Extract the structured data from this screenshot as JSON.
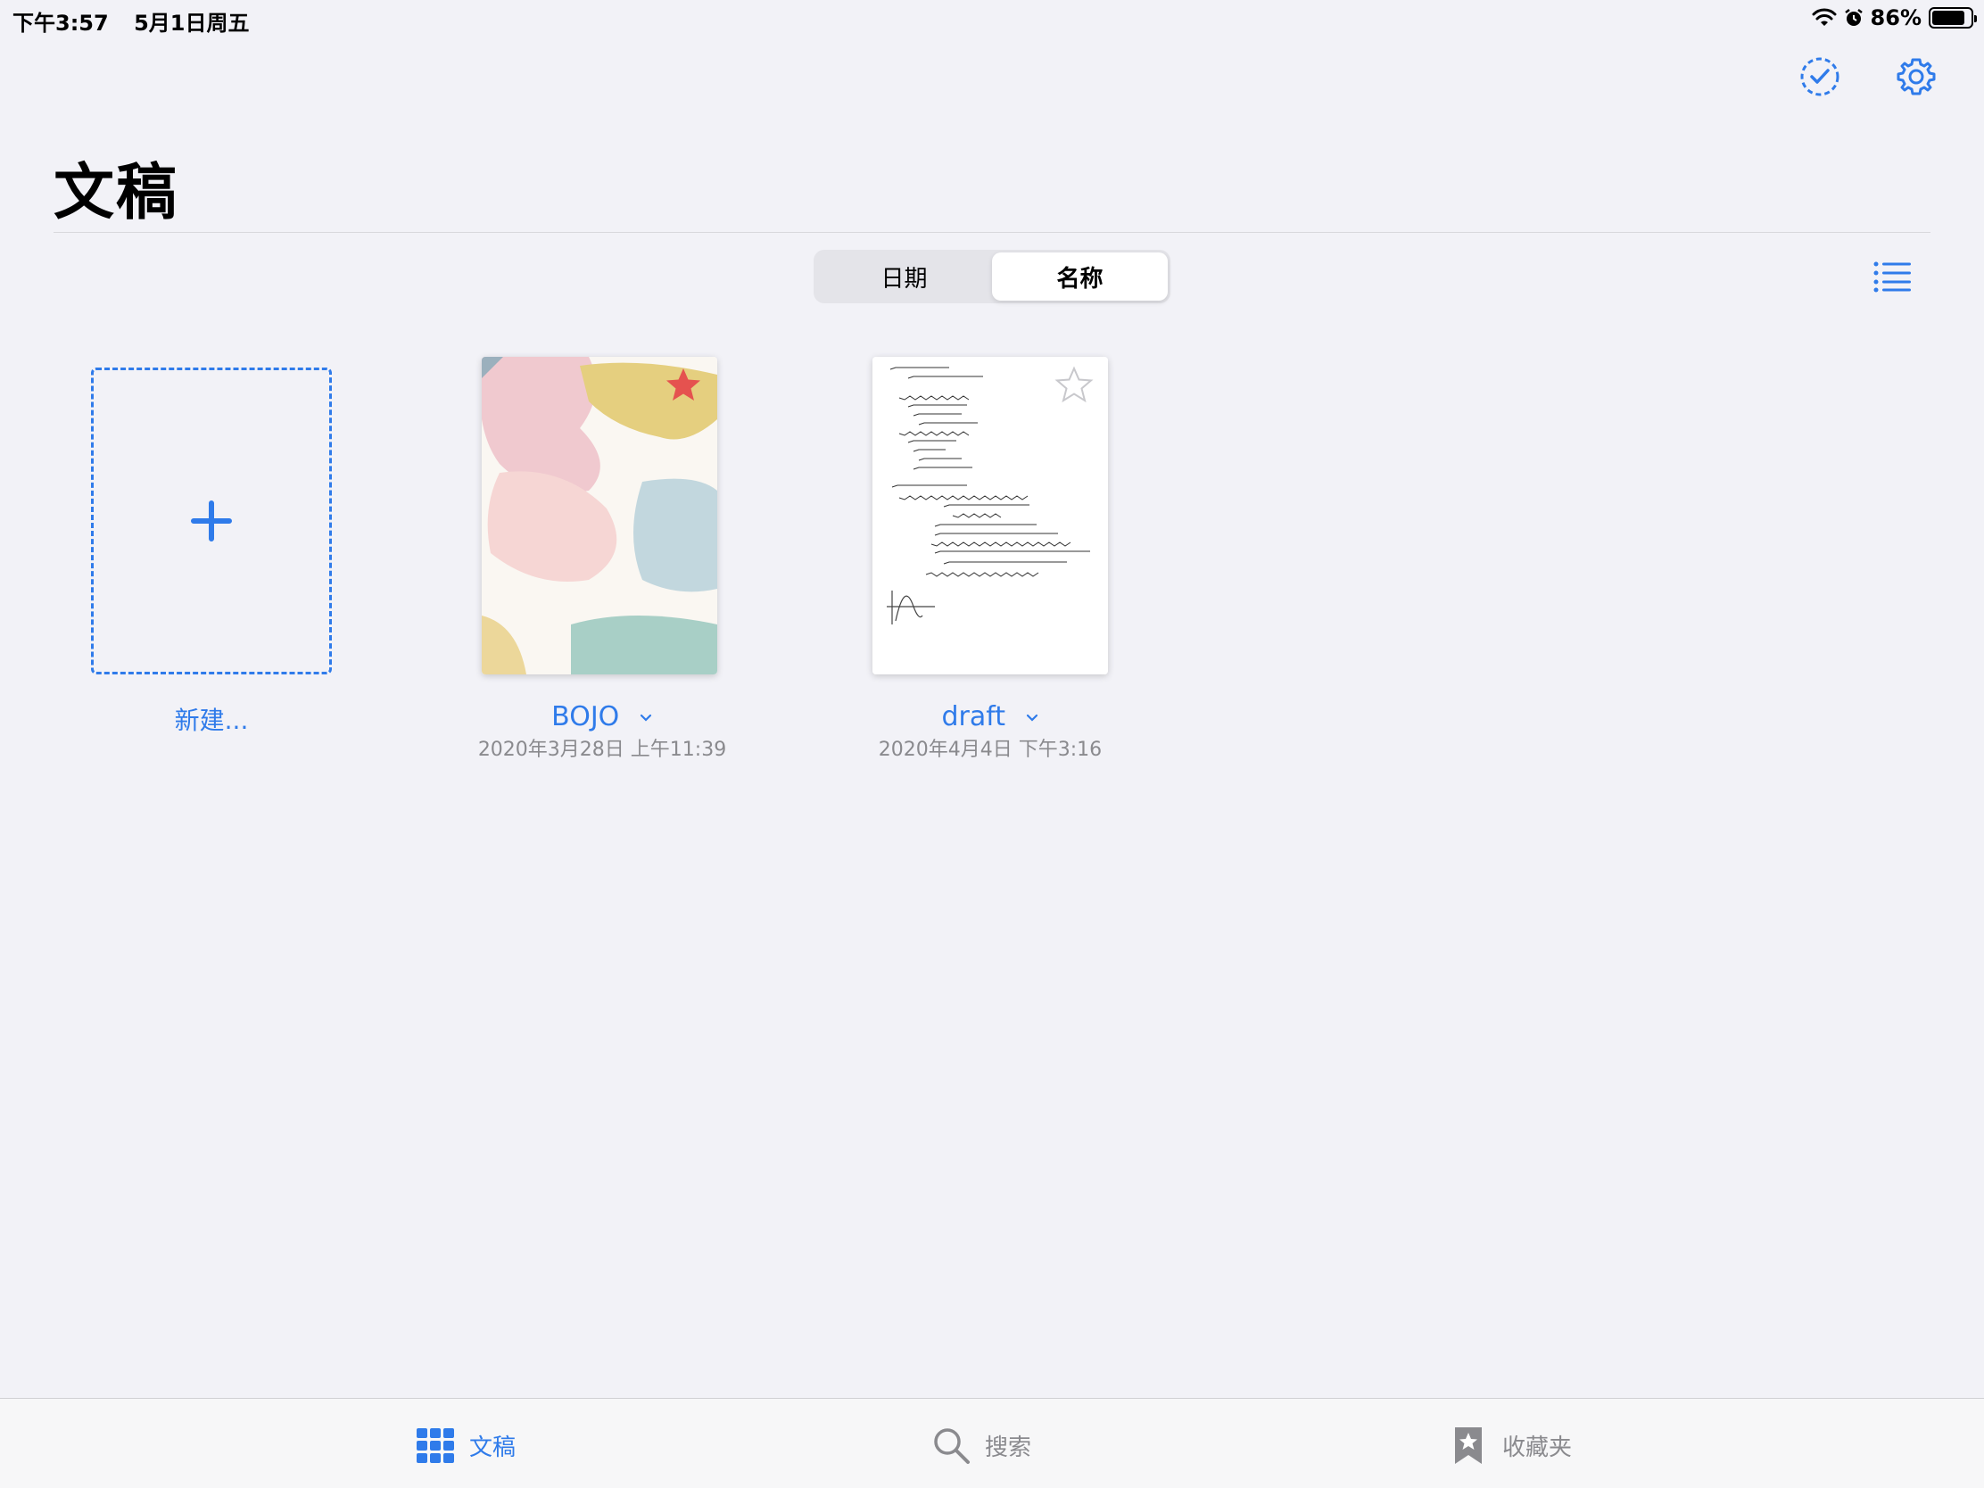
{
  "status_bar": {
    "time": "下午3:57",
    "date": "5月1日周五",
    "battery": "86%",
    "battery_level": 0.86
  },
  "header": {
    "title": "文稿"
  },
  "sort_control": {
    "options": [
      "日期",
      "名称"
    ],
    "selected": "名称"
  },
  "new_doc": {
    "label": "新建..."
  },
  "documents": [
    {
      "title": "BOJO",
      "date": "2020年3月28日 上午11:39",
      "favorite": true
    },
    {
      "title": "draft",
      "date": "2020年4月4日 下午3:16",
      "favorite": false
    }
  ],
  "tabs": [
    {
      "label": "文稿",
      "icon": "grid-icon",
      "active": true
    },
    {
      "label": "搜索",
      "icon": "search-icon",
      "active": false
    },
    {
      "label": "收藏夹",
      "icon": "bookmark-star-icon",
      "active": false
    }
  ],
  "colors": {
    "accent": "#2f7bea",
    "favorite_star": "#e5524f",
    "background": "#f2f2f7"
  }
}
